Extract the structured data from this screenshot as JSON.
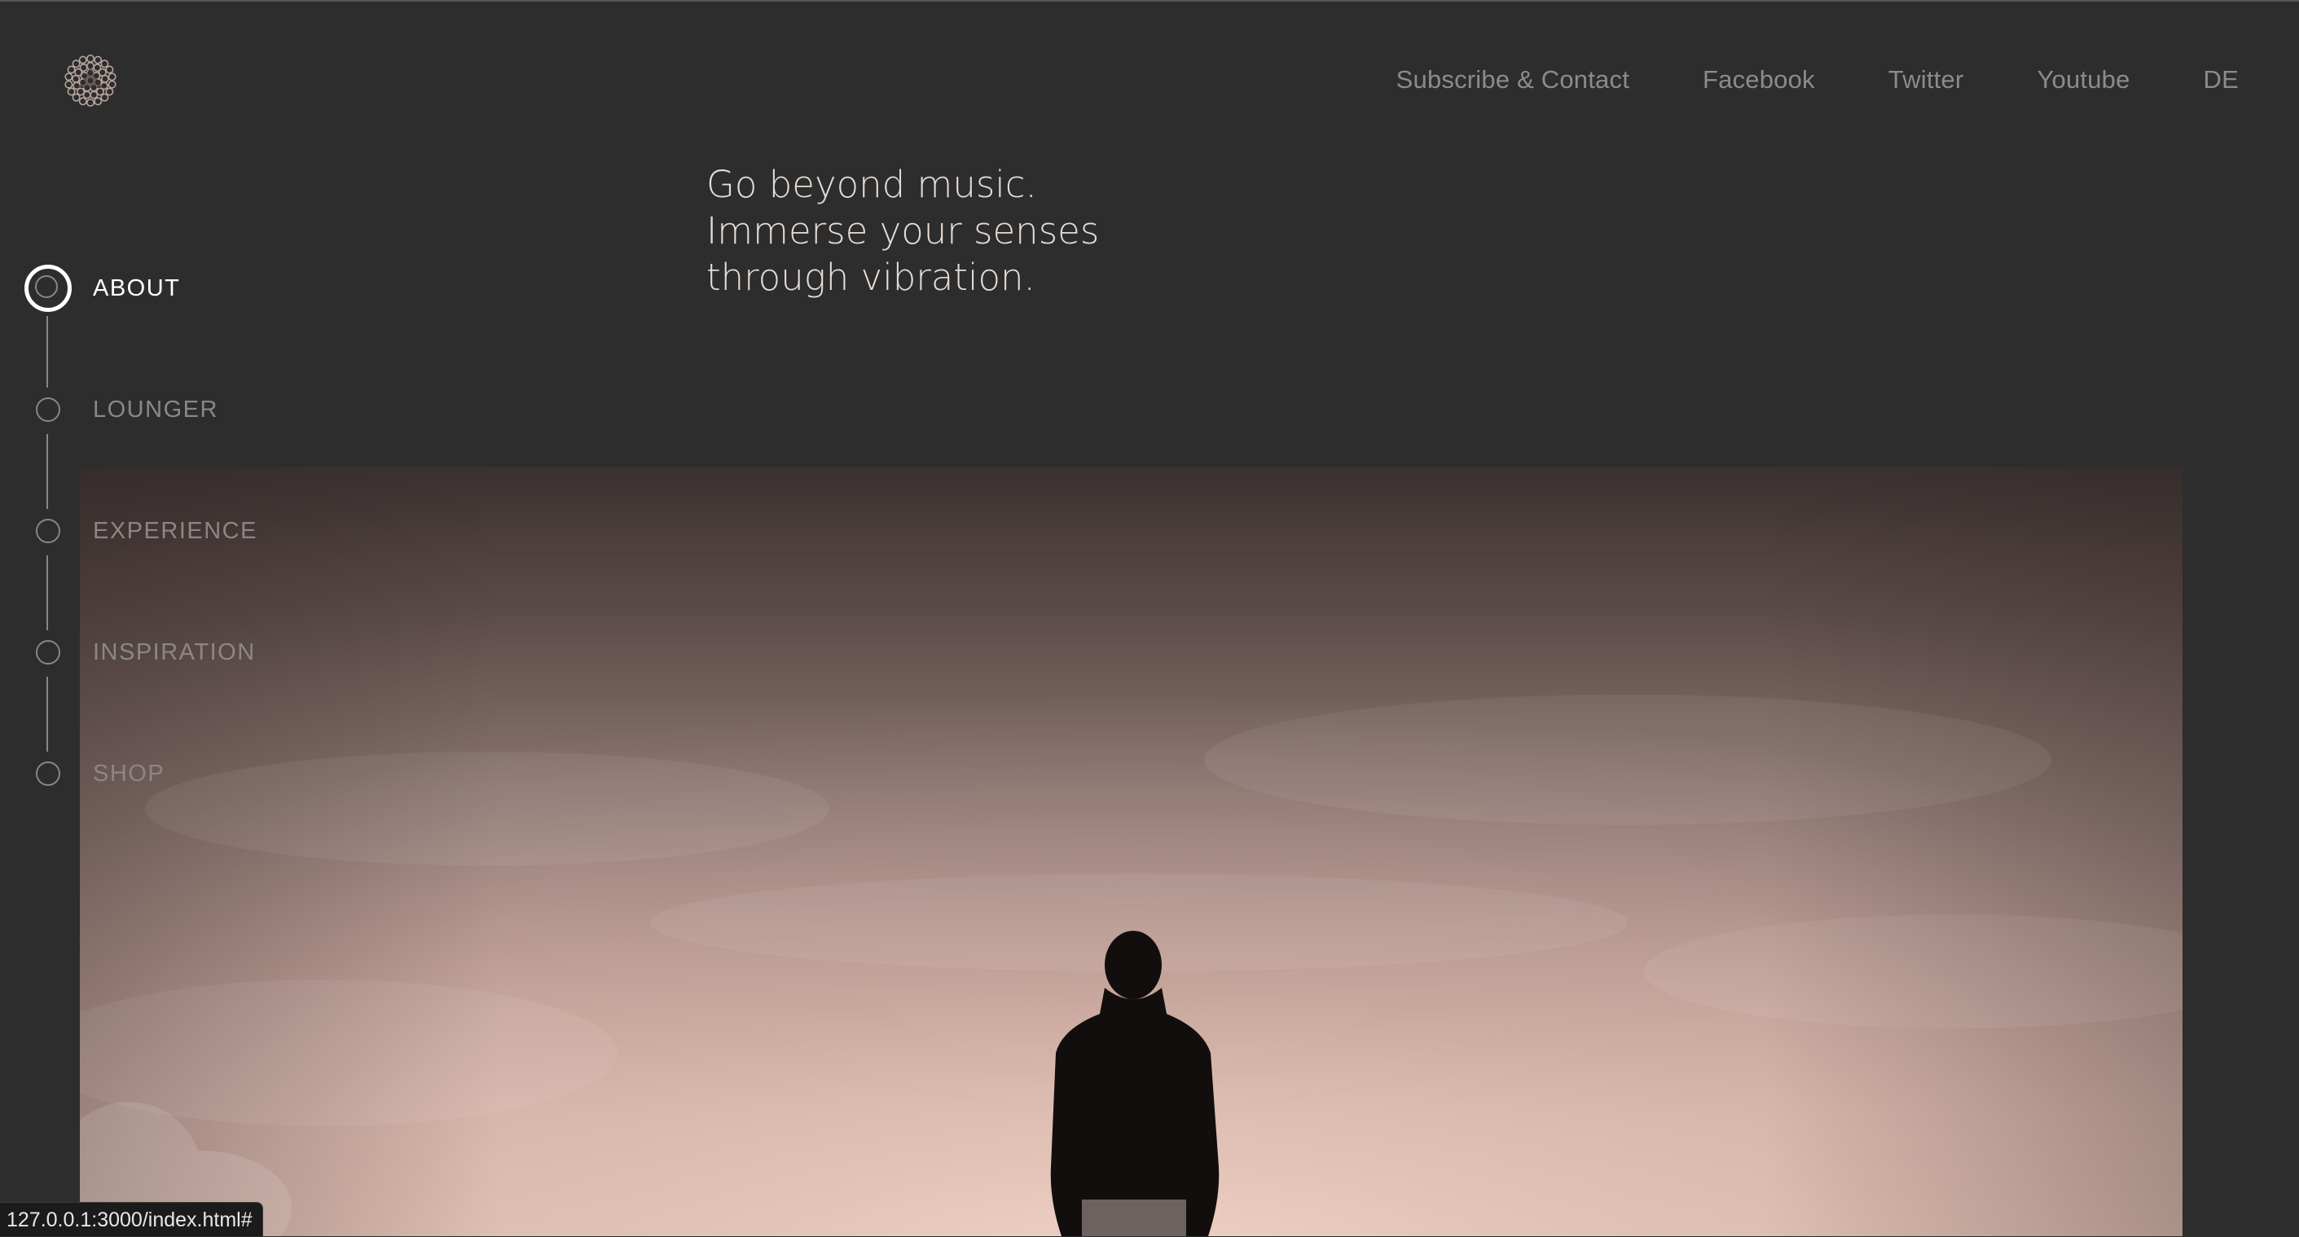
{
  "topnav": {
    "items": [
      {
        "label": "Subscribe & Contact"
      },
      {
        "label": "Facebook"
      },
      {
        "label": "Twitter"
      },
      {
        "label": "Youtube"
      },
      {
        "label": "DE"
      }
    ]
  },
  "headline": {
    "lines": [
      "Go beyond music.",
      "Immerse your senses",
      "through vibration."
    ]
  },
  "sidenav": {
    "items": [
      {
        "label": "ABOUT",
        "active": true
      },
      {
        "label": "LOUNGER",
        "active": false
      },
      {
        "label": "EXPERIENCE",
        "active": false
      },
      {
        "label": "INSPIRATION",
        "active": false
      },
      {
        "label": "SHOP",
        "active": false
      }
    ]
  },
  "hero": {
    "image": "silhouette-person-at-dusk"
  },
  "statusbar": {
    "url": "127.0.0.1:3000/index.html#"
  },
  "colors": {
    "background": "#2d2d2d",
    "headline": "#e5dcd6",
    "nav_inactive": "#8b8785",
    "nav_active": "#ffffff"
  },
  "icons": {
    "logo": "lotus-circles-logo"
  }
}
